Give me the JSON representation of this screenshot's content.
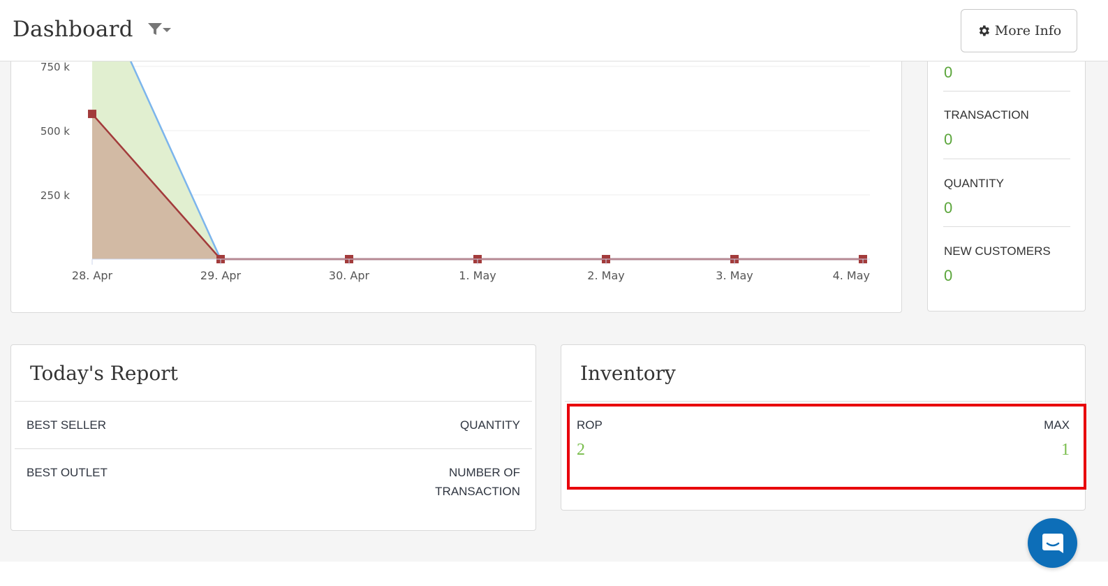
{
  "header": {
    "title": "Dashboard",
    "filter_icon": "filter-icon",
    "more_info_label": "More Info",
    "more_info_icon": "gear-icon"
  },
  "chart_data": {
    "type": "area",
    "categories": [
      "28. Apr",
      "29. Apr",
      "30. Apr",
      "1. May",
      "2. May",
      "3. May",
      "4. May"
    ],
    "series": [
      {
        "values": [
          1100000,
          0,
          0,
          0,
          0,
          0,
          0
        ],
        "color": "#7cb5ec",
        "fill": "#e1efd0"
      },
      {
        "values": [
          565000,
          0,
          0,
          0,
          0,
          0,
          0
        ],
        "color": "#a23b3b",
        "fill": "#d2baa4"
      }
    ],
    "y_ticks": [
      "250 k",
      "500 k",
      "750 k"
    ],
    "ylim": [
      0,
      750000
    ],
    "grid": true
  },
  "stats": [
    {
      "label": "",
      "value": "0"
    },
    {
      "label": "TRANSACTION",
      "value": "0"
    },
    {
      "label": "QUANTITY",
      "value": "0"
    },
    {
      "label": "NEW CUSTOMERS",
      "value": "0"
    }
  ],
  "report": {
    "title": "Today's Report",
    "rows": [
      {
        "label": "BEST SELLER",
        "right": "QUANTITY"
      },
      {
        "label": "BEST OUTLET",
        "right_line1": "NUMBER OF",
        "right_line2": "TRANSACTION"
      }
    ]
  },
  "inventory": {
    "title": "Inventory",
    "rop_label": "ROP",
    "rop_value": "2",
    "max_label": "MAX",
    "max_value": "1"
  },
  "colors": {
    "accent_green": "#5ba53b",
    "highlight_red": "#e8000b",
    "chat_blue": "#0d6eb8"
  },
  "chat": {
    "icon": "chat-icon"
  }
}
